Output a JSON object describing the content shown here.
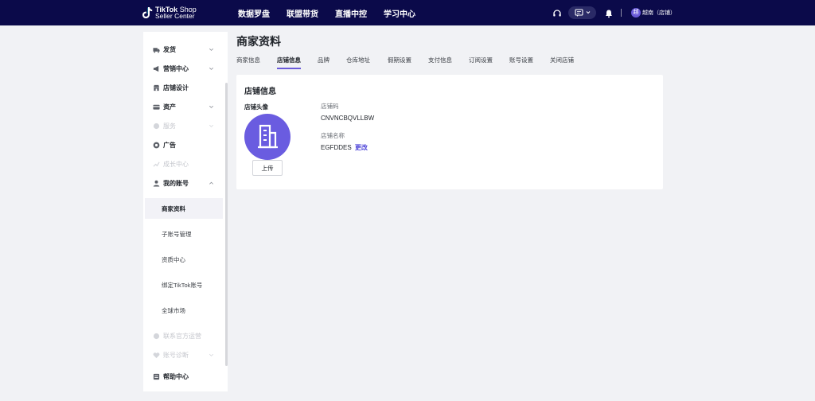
{
  "header": {
    "logo_brand": "TikTok",
    "logo_suffix": "Shop",
    "logo_sub": "Seller Center",
    "nav": [
      "数据罗盘",
      "联盟带货",
      "直播中控",
      "学习中心"
    ],
    "avatar_text": "越",
    "shop_label": "越南（店铺）",
    "accent": "#0b0a4a"
  },
  "sidebar": {
    "items": [
      {
        "label": "发货",
        "icon": "truck-icon",
        "chevron": true,
        "disabled": false
      },
      {
        "label": "营销中心",
        "icon": "megaphone-icon",
        "chevron": true,
        "disabled": false
      },
      {
        "label": "店铺设计",
        "icon": "store-icon",
        "chevron": false,
        "disabled": false
      },
      {
        "label": "资产",
        "icon": "wallet-icon",
        "chevron": true,
        "disabled": false
      },
      {
        "label": "服务",
        "icon": "service-icon",
        "chevron": true,
        "disabled": true
      },
      {
        "label": "广告",
        "icon": "ad-icon",
        "chevron": false,
        "disabled": false
      },
      {
        "label": "成长中心",
        "icon": "growth-icon",
        "chevron": false,
        "disabled": true
      },
      {
        "label": "我的账号",
        "icon": "account-icon",
        "chevron": true,
        "disabled": false
      }
    ],
    "subitems": [
      "商家资料",
      "子账号管理",
      "资质中心",
      "绑定TikTok账号",
      "全球市场"
    ],
    "active_subitem": "商家资料",
    "bottom_items": [
      {
        "label": "联系官方运营",
        "icon": "contact-icon",
        "disabled": true
      },
      {
        "label": "账号诊断",
        "icon": "diagnosis-icon",
        "disabled": true
      },
      {
        "label": "帮助中心",
        "icon": "help-icon",
        "disabled": false
      }
    ]
  },
  "main": {
    "title": "商家资料",
    "tabs": [
      "商家信息",
      "店铺信息",
      "品牌",
      "仓库地址",
      "假期设置",
      "支付信息",
      "订阅设置",
      "账号设置",
      "关闭店铺"
    ],
    "active_tab": "店铺信息",
    "card": {
      "title": "店铺信息",
      "avatar_label": "店铺头像",
      "upload_label": "上传",
      "store_code_label": "店铺码",
      "store_code": "CNVNCBQVLLBW",
      "store_name_label": "店铺名称",
      "store_name": "EGFDDES",
      "change_label": "更改"
    }
  },
  "colors": {
    "primary": "#6b5bd9",
    "link": "#4f46d9",
    "avatar_bg": "#6a5ce0"
  }
}
